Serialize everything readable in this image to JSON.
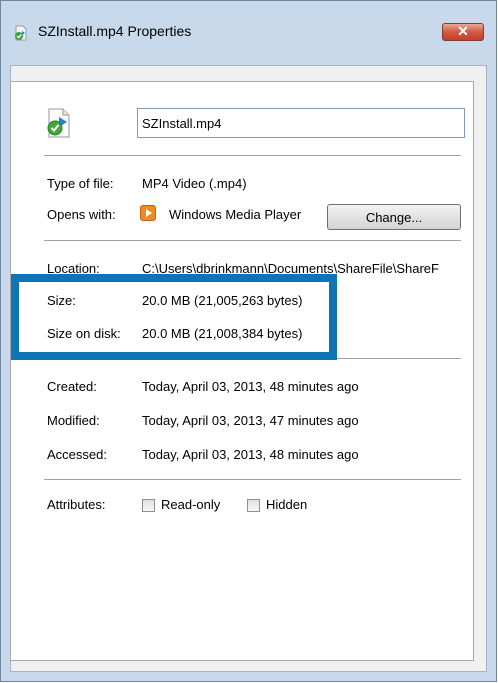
{
  "window": {
    "title": "SZInstall.mp4 Properties",
    "close_label": "✕"
  },
  "file": {
    "name": "SZInstall.mp4"
  },
  "type": {
    "label": "Type of file:",
    "value": "MP4 Video (.mp4)"
  },
  "opens": {
    "label": "Opens with:",
    "value": "Windows Media Player",
    "button": "Change..."
  },
  "location": {
    "label": "Location:",
    "value": "C:\\Users\\dbrinkmann\\Documents\\ShareFile\\ShareF"
  },
  "size": {
    "label": "Size:",
    "value": "20.0 MB (21,005,263 bytes)"
  },
  "size_on_disk": {
    "label": "Size on disk:",
    "value": "20.0 MB (21,008,384 bytes)"
  },
  "created": {
    "label": "Created:",
    "value": "Today, April 03, 2013, 48 minutes ago"
  },
  "modified": {
    "label": "Modified:",
    "value": "Today, April 03, 2013, 47 minutes ago"
  },
  "accessed": {
    "label": "Accessed:",
    "value": "Today, April 03, 2013, 48 minutes ago"
  },
  "attributes": {
    "label": "Attributes:",
    "readonly": "Read-only",
    "hidden": "Hidden"
  },
  "colors": {
    "highlight": "#0f74b6",
    "titlebar": "#c8d9ec",
    "close": "#c74b35"
  },
  "icons": {
    "title": "video-file-icon",
    "file": "video-file-icon",
    "app": "windows-media-player-icon"
  }
}
